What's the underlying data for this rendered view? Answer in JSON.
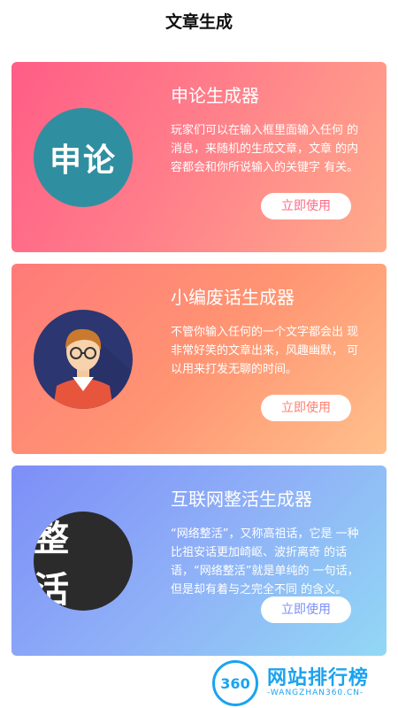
{
  "page": {
    "title": "文章生成"
  },
  "cards": [
    {
      "title": "申论生成器",
      "icon_text": "申论",
      "icon": "shenlun-text-icon",
      "desc": "玩家们可以在输入框里面输入任何 的消息，来随机的生成文章，文章 的内容都会和你所说输入的关键字 有关。",
      "button": "立即使用"
    },
    {
      "title": "小编废话生成器",
      "icon": "person-avatar-icon",
      "desc": "不管你输入任何的一个文字都会出 现非常好笑的文章出来，风趣幽默， 可以用来打发无聊的时间。",
      "button": "立即使用"
    },
    {
      "title": "互联网整活生成器",
      "icon_text": "整 活",
      "icon": "zhenghuo-text-icon",
      "desc": "“网络整活”，又称高祖话，它是 一种比祖安话更加崎岖、波折离奇 的话语，“网络整活”就是单纯的 一句话，但是却有着与之完全不同 的含义。",
      "button": "立即使用"
    }
  ],
  "watermark": {
    "badge": "360",
    "name": "网站排行榜",
    "domain": "-WANGZHAN360.CN-"
  },
  "colors": {
    "card1_accent": "#ff6a86",
    "card2_accent": "#ff8072",
    "card3_accent": "#7d8ef7",
    "logo": "#1aa3f0"
  }
}
